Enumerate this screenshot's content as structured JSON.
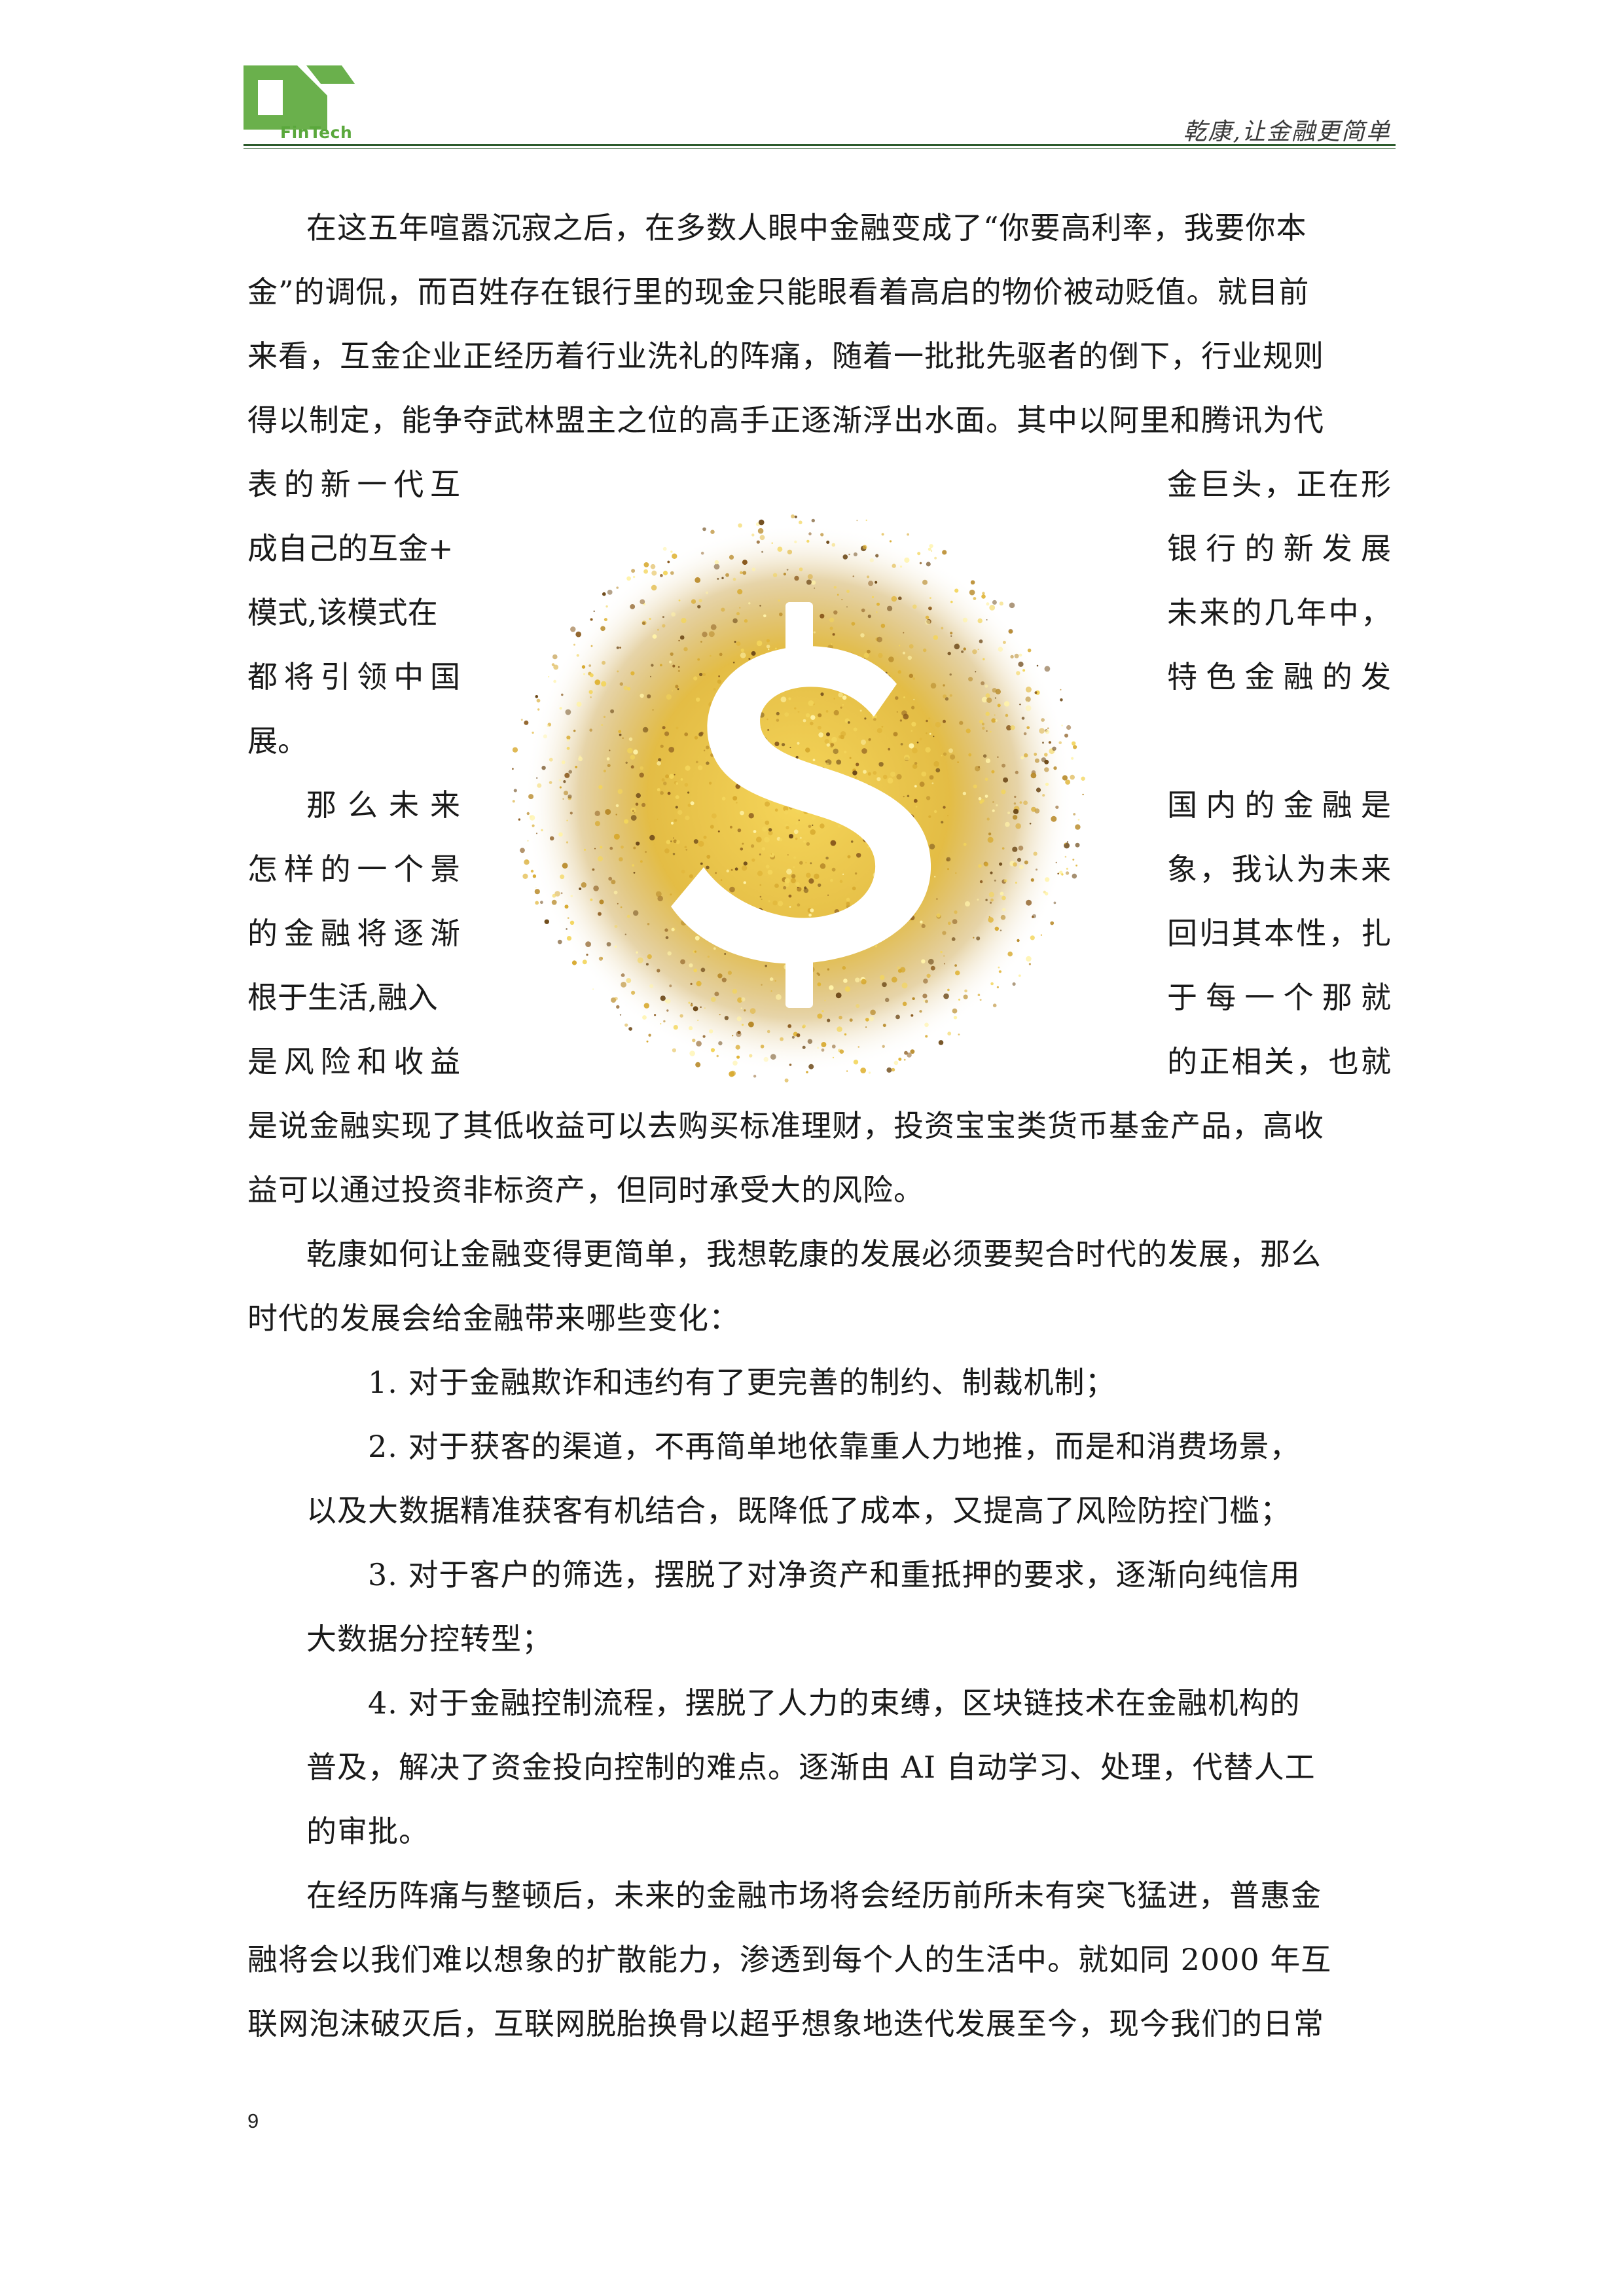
{
  "header": {
    "logo_text": "FinTech",
    "slogan": "乾康,让金融更简单"
  },
  "body": {
    "p1": [
      "在这五年喧嚣沉寂之后，在多数人眼中金融变成了“你要高利率，我要你本",
      "金”的调侃，而百姓存在银行里的现金只能眼看着高启的物价被动贬值。就目前",
      "来看，互金企业正经历着行业洗礼的阵痛，随着一批批先驱者的倒下，行业规则",
      "得以制定，能争夺武林盟主之位的高手正逐渐浮出水面。其中以阿里和腾讯为代"
    ],
    "p1_wrap_left": [
      "表的新一代互",
      "成自己的互金+",
      "模式,该模式在",
      "都将引领中国"
    ],
    "p1_wrap_right": [
      "金巨头，正在形",
      "银行的新发展",
      "未来的几年中，",
      "特色金融的发"
    ],
    "p1_end": "展。",
    "p2_wrap_left": [
      "那么未来",
      "怎样的一个景",
      "的金融将逐渐",
      "根于生活,融入",
      "是风险和收益"
    ],
    "p2_wrap_right": [
      "国内的金融是",
      "象，我认为未来",
      "回归其本性，扎",
      "于每一个那就",
      "的正相关，也就"
    ],
    "p2_end": [
      "是说金融实现了其低收益可以去购买标准理财，投资宝宝类货币基金产品，高收",
      "益可以通过投资非标资产，但同时承受大的风险。"
    ],
    "p3": [
      "乾康如何让金融变得更简单，我想乾康的发展必须要契合时代的发展，那么",
      "时代的发展会给金融带来哪些变化："
    ],
    "list": [
      [
        "1.  对于金融欺诈和违约有了更完善的制约、制裁机制；"
      ],
      [
        "2.  对于获客的渠道，不再简单地依靠重人力地推，而是和消费场景，",
        "以及大数据精准获客有机结合，既降低了成本，又提高了风险防控门槛；"
      ],
      [
        "3.  对于客户的筛选，摆脱了对净资产和重抵押的要求，逐渐向纯信用",
        "大数据分控转型；"
      ],
      [
        "4.  对于金融控制流程，摆脱了人力的束缚，区块链技术在金融机构的",
        "普及，解决了资金投向控制的难点。逐渐由 AI 自动学习、处理，代替人工",
        "的审批。"
      ]
    ],
    "p4": [
      "在经历阵痛与整顿后，未来的金融市场将会经历前所未有突飞猛进，普惠金",
      "融将会以我们难以想象的扩散能力，渗透到每个人的生活中。就如同 2000 年互",
      "联网泡沫破灭后，互联网脱胎换骨以超乎想象地迭代发展至今，现今我们的日常"
    ]
  },
  "page_number": "9",
  "colors": {
    "brand_green": "#5aa83c",
    "rule": "#2c5b2c",
    "gold": "#d9b23a"
  }
}
